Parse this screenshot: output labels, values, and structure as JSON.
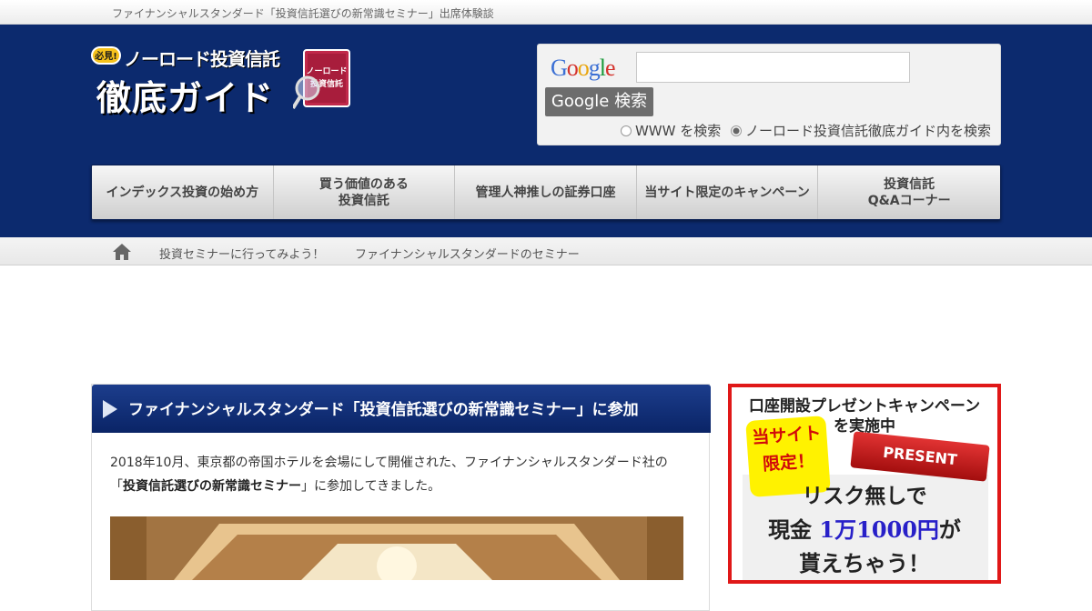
{
  "topbar": {
    "text": "ファイナンシャルスタンダード「投資信託選びの新常識セミナー」出席体験談"
  },
  "logo": {
    "badge": "必見!",
    "line1": "ノーロード投資信託",
    "line2": "徹底ガイド",
    "book_text": "ノーロード投資信託"
  },
  "search": {
    "engine_logo": "Google",
    "input_value": "",
    "button_label": "Google 検索",
    "radio_www": "WWW を検索",
    "radio_site": "ノーロード投資信託徹底ガイド内を検索",
    "selected": "site"
  },
  "nav": [
    {
      "label": "インデックス投資の始め方"
    },
    {
      "label": "買う価値のある\n投資信託"
    },
    {
      "label": "管理人神推しの証券口座"
    },
    {
      "label": "当サイト限定のキャンペーン"
    },
    {
      "label": "投資信託\nQ&Aコーナー"
    }
  ],
  "breadcrumb": {
    "items": [
      "投資セミナーに行ってみよう！",
      "ファイナンシャルスタンダードのセミナー"
    ]
  },
  "article": {
    "title": "ファイナンシャルスタンダード「投資信託選びの新常識セミナー」に参加",
    "body_pre": "2018年10月、東京都の帝国ホテルを会場にして開催された、ファイナンシャルスタンダード社の「",
    "body_bold": "投資信託選びの新常識セミナー",
    "body_post": "」に参加してきました。"
  },
  "sidebar": {
    "title1": "口座開設プレゼントキャンペーン",
    "title2": "を実施中",
    "note1": "当サイト",
    "note2": "限定！",
    "ribbon": "PRESENT",
    "line1": "リスク無しで",
    "line2_pre": "現金 ",
    "line2_amount": "1万1000円",
    "line2_post": "が",
    "line3": "貰えちゃう！"
  },
  "colors": {
    "header_bg": "#0c2a6e",
    "title_bg": "#0a2466",
    "campaign_border": "#e01818",
    "amount": "#2820c8"
  }
}
